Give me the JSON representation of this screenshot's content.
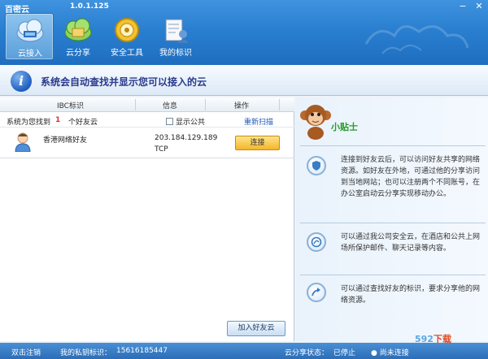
{
  "app": {
    "name": "百密云",
    "version": "1.0.1.125"
  },
  "nav": {
    "tabs": [
      {
        "label": "云接入",
        "icon": "cloud-connect-icon",
        "active": true
      },
      {
        "label": "云分享",
        "icon": "cloud-share-icon",
        "active": false
      },
      {
        "label": "安全工具",
        "icon": "security-tools-icon",
        "active": false
      },
      {
        "label": "我的标识",
        "icon": "my-id-icon",
        "active": false
      }
    ]
  },
  "window_controls": {
    "minimize": "−",
    "close": "✕"
  },
  "banner": {
    "text": "系统会自动查找并显示您可以接入的云",
    "icon": "info-icon"
  },
  "table": {
    "headers": {
      "ibc": "IBC标识",
      "info": "信息",
      "action": "操作"
    },
    "filter": {
      "found_label": "系统为您找到",
      "found_count": "1",
      "found_suffix": "个好友云",
      "show_public": "显示公共",
      "rescan": "重新扫描"
    },
    "rows": [
      {
        "name": "香港网络好友",
        "ip": "203.184.129.189",
        "protocol": "TCP",
        "action_label": "连接"
      }
    ]
  },
  "add_friend": {
    "label": "加入好友云"
  },
  "tips": {
    "title": "小贴士",
    "items": [
      {
        "icon": "shield-icon",
        "text": "连接到好友云后，可以访问好友共享的网络资源。如好友在外地，可通过他的分享访问到当地网站；也可以注册两个不同账号，在办公室启动云分享实现移动办公。"
      },
      {
        "icon": "globe-icon",
        "text": "可以通过我公司安全云，在酒店和公共上网场所保护邮件、聊天记录等内容。"
      },
      {
        "icon": "share-arrow-icon",
        "text": "可以通过查找好友的标识，要求分享他的网络资源。"
      }
    ]
  },
  "status": {
    "logout": "双击注销",
    "my_id_label": "我的私钥标识：",
    "my_id": "15616185447",
    "share_status_label": "云分享状态：",
    "share_status": "已停止",
    "connection": "尚未连接",
    "watermark_num": "592",
    "watermark_text": "下载"
  },
  "colors": {
    "toolbar": "#2a7fd0",
    "banner_text": "#2a3a8c",
    "tip_title": "#279a2a",
    "connect_button": "#f4b62a"
  }
}
